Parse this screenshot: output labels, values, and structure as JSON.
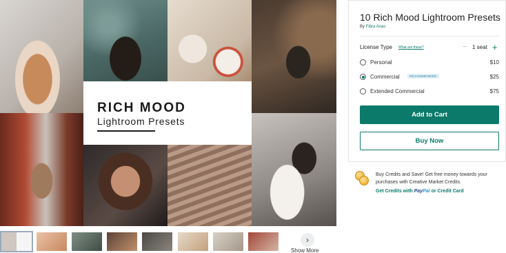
{
  "preview": {
    "title_line1": "RICH MOOD",
    "title_line2": "Lightroom Presets"
  },
  "thumbnails": {
    "count": 8,
    "active_index": 0,
    "more_icon": "chevron-right-icon",
    "more_label": "Show More"
  },
  "product": {
    "title": "10 Rich Mood Lightroom Presets",
    "by_prefix": "By",
    "author": "Fibra Anas"
  },
  "license": {
    "label": "License Type",
    "help_link": "What are these?",
    "seats": "1 seat",
    "options": [
      {
        "name": "Personal",
        "price": "$10",
        "selected": false
      },
      {
        "name": "Commercial",
        "price": "$25",
        "selected": true,
        "badge": "RECOMMENDED"
      },
      {
        "name": "Extended Commercial",
        "price": "$75",
        "selected": false
      }
    ]
  },
  "actions": {
    "add_to_cart": "Add to Cart",
    "buy_now": "Buy Now"
  },
  "credits": {
    "line1": "Buy Credits and Save! Get free money towards your",
    "line2": "purchases with Creative Market Credits.",
    "link_prefix": "Get Credits with",
    "paypal_a": "Pay",
    "paypal_b": "Pal",
    "link_suffix": "or Credit Card"
  },
  "colors": {
    "accent": "#0b7a6a",
    "badge_bg": "#e2f1f7",
    "badge_text": "#2d7fa0"
  }
}
